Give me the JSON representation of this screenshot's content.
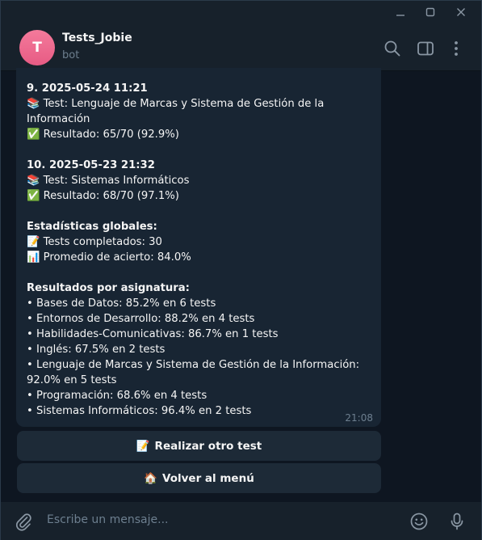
{
  "window": {
    "controls": [
      "minimize",
      "maximize",
      "close"
    ]
  },
  "header": {
    "avatar_letter": "T",
    "title": "Tests_Jobie",
    "subtitle": "bot",
    "icons": [
      "search-icon",
      "sidebar-toggle-icon",
      "more-vertical-icon"
    ]
  },
  "message": {
    "lines": [
      {
        "text": "9. 2025-05-24 11:21",
        "bold": true
      },
      {
        "text": "📚 Test: Lenguaje de Marcas y Sistema de Gestión de la Información",
        "bold": false
      },
      {
        "text": "✅ Resultado: 65/70 (92.9%)",
        "bold": false
      },
      {
        "text": "",
        "bold": false
      },
      {
        "text": "10. 2025-05-23 21:32",
        "bold": true
      },
      {
        "text": "📚 Test: Sistemas Informáticos",
        "bold": false
      },
      {
        "text": "✅ Resultado: 68/70 (97.1%)",
        "bold": false
      },
      {
        "text": "",
        "bold": false
      },
      {
        "text": "Estadísticas globales:",
        "bold": true
      },
      {
        "text": "📝 Tests completados: 30",
        "bold": false
      },
      {
        "text": "📊 Promedio de acierto: 84.0%",
        "bold": false
      },
      {
        "text": "",
        "bold": false
      },
      {
        "text": "Resultados por asignatura:",
        "bold": true
      },
      {
        "text": "• Bases de Datos: 85.2% en 6 tests",
        "bold": false
      },
      {
        "text": "• Entornos de Desarrollo: 88.2% en 4 tests",
        "bold": false
      },
      {
        "text": "• Habilidades-Comunicativas: 86.7% en 1 tests",
        "bold": false
      },
      {
        "text": "• Inglés: 67.5% en 2 tests",
        "bold": false
      },
      {
        "text": "• Lenguaje de Marcas y Sistema de Gestión de la Información: 92.0% en 5 tests",
        "bold": false
      },
      {
        "text": "• Programación: 68.6% en 4 tests",
        "bold": false
      },
      {
        "text": "• Sistemas Informáticos: 96.4% en 2 tests",
        "bold": false
      }
    ],
    "time": "21:08"
  },
  "keyboard": {
    "buttons": [
      {
        "emoji": "📝",
        "label": "Realizar otro test"
      },
      {
        "emoji": "🏠",
        "label": "Volver al menú"
      }
    ]
  },
  "composer": {
    "placeholder": "Escribe un mensaje...",
    "icons": [
      "attach-icon",
      "emoji-icon",
      "microphone-icon"
    ]
  },
  "colors": {
    "background": "#0e1621",
    "panel": "#17212b",
    "bubble": "#182533",
    "button": "#1d2a37",
    "muted_text": "#6d7f8f",
    "avatar": "#e75b84"
  }
}
